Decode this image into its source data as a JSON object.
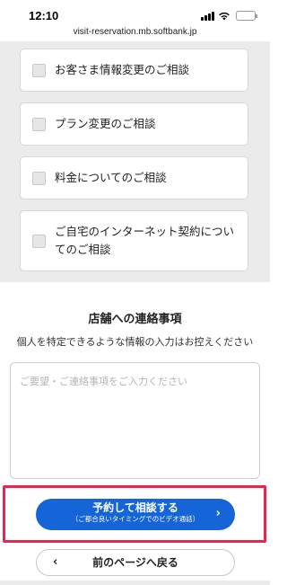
{
  "status_bar": {
    "time": "12:10"
  },
  "browser": {
    "url": "visit-reservation.mb.softbank.jp"
  },
  "options": [
    {
      "label": "お客さま情報変更のご相談"
    },
    {
      "label": "プラン変更のご相談"
    },
    {
      "label": "料金についてのご相談"
    },
    {
      "label_line1": "ご自宅のインターネット契約につい",
      "label_line2": "てのご相談"
    }
  ],
  "notice": {
    "title": "店舗への連絡事項",
    "subtitle": "個人を特定できるような情報の入力はお控えください",
    "placeholder": "ご要望・ご連絡事項をご入力ください"
  },
  "primary_button": {
    "label": "予約して相談する",
    "sublabel": "（ご都合良いタイミングでのビデオ通話）",
    "chevron": "›"
  },
  "back_button": {
    "label": "前のページへ戻る",
    "chevron": "‹"
  },
  "colors": {
    "primary": "#1565d8",
    "highlight": "#e8264f",
    "section_bg": "#ebebeb"
  }
}
